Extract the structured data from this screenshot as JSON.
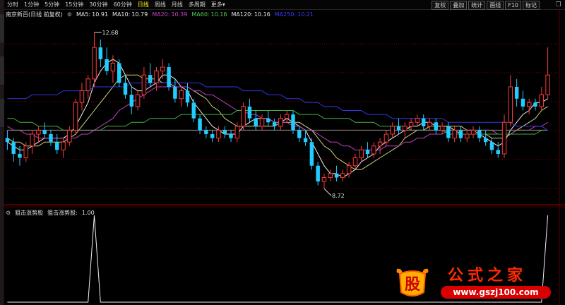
{
  "toolbar": {
    "periods": [
      "分时",
      "1分钟",
      "5分钟",
      "15分钟",
      "30分钟",
      "60分钟",
      "日线",
      "周线",
      "月线",
      "多周期",
      "更多"
    ],
    "active_period": "日线",
    "buttons": [
      "复权",
      "叠加",
      "统计",
      "画线",
      "F10",
      "标记"
    ]
  },
  "chart_title": "南京新百(日线 前复权)",
  "ma_legend": [
    {
      "label": "MA5:",
      "value": "10.91",
      "color": "#e8e8e8"
    },
    {
      "label": "MA10:",
      "value": "10.79",
      "color": "#e8e8e8"
    },
    {
      "label": "MA20:",
      "value": "10.39",
      "color": "#cc44cc"
    },
    {
      "label": "MA60:",
      "value": "10.16",
      "color": "#55cc55"
    },
    {
      "label": "MA120:",
      "value": "10.16",
      "color": "#e8e8e8"
    },
    {
      "label": "MA250:",
      "value": "10.21",
      "color": "#3a3aff"
    }
  ],
  "indicator": {
    "name": "狙击涨势股",
    "series_label": "狙击涨势股:",
    "value": "1.00"
  },
  "watermark": {
    "logo_char": "股",
    "title": "公式之家",
    "url": "www.gszj100.com"
  },
  "colors": {
    "up": "#ff3a3a",
    "down": "#22ccff",
    "grid": "#7a0000"
  },
  "chart_data": [
    {
      "type": "candlestick",
      "price_range": [
        8.4,
        13.0
      ],
      "annotations": [
        {
          "text": "12.68",
          "label": "max"
        },
        {
          "text": "8.72",
          "label": "min"
        }
      ],
      "candles": [
        [
          10.0,
          10.2,
          9.7,
          9.9
        ],
        [
          9.9,
          10.0,
          9.4,
          9.6
        ],
        [
          9.6,
          9.8,
          9.3,
          9.5
        ],
        [
          9.5,
          9.9,
          9.4,
          9.8
        ],
        [
          9.8,
          10.2,
          9.6,
          10.1
        ],
        [
          10.1,
          10.3,
          9.9,
          10.2
        ],
        [
          10.2,
          10.4,
          10.0,
          10.1
        ],
        [
          10.1,
          10.2,
          9.8,
          9.9
        ],
        [
          9.9,
          10.1,
          9.6,
          9.7
        ],
        [
          9.7,
          10.0,
          9.5,
          9.9
        ],
        [
          9.9,
          10.3,
          9.8,
          10.2
        ],
        [
          10.2,
          11.0,
          10.1,
          10.9
        ],
        [
          10.9,
          11.4,
          10.7,
          11.2
        ],
        [
          11.2,
          11.6,
          11.0,
          11.5
        ],
        [
          11.5,
          12.68,
          11.3,
          12.3
        ],
        [
          12.3,
          12.5,
          11.8,
          12.0
        ],
        [
          12.0,
          12.3,
          11.6,
          11.7
        ],
        [
          11.7,
          12.1,
          11.4,
          11.9
        ],
        [
          11.9,
          12.0,
          11.3,
          11.4
        ],
        [
          11.4,
          11.6,
          11.0,
          11.1
        ],
        [
          11.1,
          11.3,
          10.6,
          10.8
        ],
        [
          10.8,
          11.2,
          10.7,
          11.1
        ],
        [
          11.1,
          11.8,
          11.0,
          11.6
        ],
        [
          11.6,
          11.9,
          11.3,
          11.4
        ],
        [
          11.4,
          11.8,
          11.2,
          11.7
        ],
        [
          11.7,
          12.0,
          11.5,
          11.8
        ],
        [
          11.8,
          11.9,
          11.2,
          11.3
        ],
        [
          11.3,
          11.5,
          10.9,
          11.0
        ],
        [
          11.0,
          11.3,
          10.8,
          11.2
        ],
        [
          11.2,
          11.4,
          10.8,
          10.9
        ],
        [
          10.9,
          11.0,
          10.4,
          10.5
        ],
        [
          10.5,
          10.6,
          10.1,
          10.2
        ],
        [
          10.2,
          10.3,
          10.0,
          10.1
        ],
        [
          10.1,
          10.2,
          9.9,
          10.0
        ],
        [
          10.0,
          10.3,
          9.9,
          10.2
        ],
        [
          10.2,
          10.3,
          10.0,
          10.1
        ],
        [
          10.1,
          10.2,
          9.9,
          10.0
        ],
        [
          10.0,
          10.4,
          9.9,
          10.3
        ],
        [
          10.3,
          10.9,
          10.2,
          10.8
        ],
        [
          10.8,
          11.0,
          10.4,
          10.5
        ],
        [
          10.5,
          10.7,
          10.2,
          10.3
        ],
        [
          10.3,
          10.6,
          10.2,
          10.5
        ],
        [
          10.5,
          10.7,
          10.3,
          10.4
        ],
        [
          10.4,
          10.5,
          10.2,
          10.3
        ],
        [
          10.3,
          10.6,
          10.2,
          10.5
        ],
        [
          10.5,
          10.7,
          10.4,
          10.6
        ],
        [
          10.6,
          10.7,
          10.1,
          10.2
        ],
        [
          10.2,
          10.3,
          9.9,
          10.0
        ],
        [
          10.0,
          10.2,
          9.8,
          9.9
        ],
        [
          9.9,
          10.0,
          9.2,
          9.3
        ],
        [
          9.3,
          9.4,
          8.8,
          8.9
        ],
        [
          8.9,
          9.1,
          8.72,
          9.0
        ],
        [
          9.0,
          9.2,
          8.9,
          9.1
        ],
        [
          9.1,
          9.3,
          8.9,
          9.0
        ],
        [
          9.0,
          9.2,
          8.9,
          9.1
        ],
        [
          9.1,
          9.4,
          9.0,
          9.3
        ],
        [
          9.3,
          9.6,
          9.2,
          9.5
        ],
        [
          9.5,
          9.8,
          9.4,
          9.7
        ],
        [
          9.7,
          9.9,
          9.5,
          9.6
        ],
        [
          9.6,
          9.9,
          9.5,
          9.8
        ],
        [
          9.8,
          10.0,
          9.6,
          9.9
        ],
        [
          9.9,
          10.2,
          9.8,
          10.1
        ],
        [
          10.1,
          10.4,
          10.0,
          10.3
        ],
        [
          10.3,
          10.5,
          10.1,
          10.2
        ],
        [
          10.2,
          10.4,
          10.0,
          10.3
        ],
        [
          10.3,
          10.5,
          10.2,
          10.4
        ],
        [
          10.4,
          10.6,
          10.3,
          10.5
        ],
        [
          10.5,
          10.6,
          10.2,
          10.3
        ],
        [
          10.3,
          10.5,
          10.2,
          10.4
        ],
        [
          10.4,
          10.5,
          10.1,
          10.2
        ],
        [
          10.2,
          10.4,
          10.1,
          10.3
        ],
        [
          10.3,
          10.4,
          9.9,
          10.0
        ],
        [
          10.0,
          10.3,
          9.9,
          10.2
        ],
        [
          10.2,
          10.3,
          9.9,
          10.0
        ],
        [
          10.0,
          10.2,
          9.9,
          10.1
        ],
        [
          10.1,
          10.3,
          10.0,
          10.2
        ],
        [
          10.2,
          10.3,
          9.9,
          10.0
        ],
        [
          10.0,
          10.2,
          9.8,
          9.9
        ],
        [
          9.9,
          10.0,
          9.6,
          9.7
        ],
        [
          9.7,
          9.9,
          9.5,
          9.6
        ],
        [
          9.6,
          10.6,
          9.5,
          10.4
        ],
        [
          10.4,
          11.6,
          10.3,
          11.3
        ],
        [
          11.3,
          11.5,
          10.8,
          11.0
        ],
        [
          11.0,
          11.2,
          10.7,
          10.8
        ],
        [
          10.8,
          11.0,
          10.6,
          10.9
        ],
        [
          10.9,
          11.0,
          10.7,
          10.8
        ],
        [
          10.8,
          11.3,
          10.7,
          11.1
        ],
        [
          11.1,
          12.3,
          11.0,
          11.6
        ]
      ],
      "ma": {
        "MA5": [
          9.9,
          9.8,
          9.7,
          9.7,
          9.8,
          9.9,
          10.0,
          10.0,
          10.0,
          10.0,
          10.1,
          10.3,
          10.6,
          10.9,
          11.4,
          11.7,
          11.9,
          12.0,
          11.9,
          11.6,
          11.3,
          11.2,
          11.2,
          11.3,
          11.4,
          11.6,
          11.6,
          11.5,
          11.3,
          11.2,
          10.9,
          10.7,
          10.5,
          10.3,
          10.2,
          10.1,
          10.1,
          10.1,
          10.3,
          10.4,
          10.5,
          10.5,
          10.5,
          10.4,
          10.4,
          10.5,
          10.4,
          10.3,
          10.2,
          9.9,
          9.6,
          9.3,
          9.1,
          9.1,
          9.0,
          9.1,
          9.2,
          9.4,
          9.5,
          9.6,
          9.8,
          9.9,
          10.0,
          10.1,
          10.2,
          10.3,
          10.3,
          10.4,
          10.4,
          10.3,
          10.3,
          10.3,
          10.2,
          10.1,
          10.1,
          10.1,
          10.1,
          10.0,
          9.9,
          9.8,
          9.9,
          10.2,
          10.4,
          10.6,
          10.7,
          10.9,
          10.9,
          11.0
        ],
        "MA10": [
          10.0,
          9.9,
          9.9,
          9.8,
          9.8,
          9.8,
          9.9,
          9.9,
          9.9,
          9.9,
          10.0,
          10.1,
          10.3,
          10.5,
          10.7,
          10.9,
          11.1,
          11.3,
          11.5,
          11.6,
          11.6,
          11.6,
          11.5,
          11.5,
          11.5,
          11.4,
          11.4,
          11.3,
          11.3,
          11.3,
          11.2,
          11.1,
          11.0,
          10.8,
          10.7,
          10.5,
          10.4,
          10.3,
          10.3,
          10.3,
          10.3,
          10.3,
          10.3,
          10.3,
          10.4,
          10.4,
          10.4,
          10.4,
          10.3,
          10.2,
          10.0,
          9.8,
          9.7,
          9.5,
          9.4,
          9.3,
          9.2,
          9.2,
          9.3,
          9.4,
          9.5,
          9.6,
          9.7,
          9.8,
          10.0,
          10.1,
          10.2,
          10.2,
          10.3,
          10.3,
          10.3,
          10.3,
          10.3,
          10.3,
          10.2,
          10.2,
          10.1,
          10.1,
          10.0,
          10.0,
          10.0,
          10.1,
          10.2,
          10.3,
          10.4,
          10.5,
          10.7,
          10.8
        ],
        "MA20": [
          10.3,
          10.2,
          10.2,
          10.1,
          10.1,
          10.0,
          10.0,
          10.0,
          10.0,
          10.0,
          10.0,
          10.0,
          10.1,
          10.1,
          10.2,
          10.3,
          10.4,
          10.5,
          10.7,
          10.8,
          10.9,
          11.0,
          11.1,
          11.2,
          11.3,
          11.3,
          11.3,
          11.3,
          11.3,
          11.3,
          11.2,
          11.2,
          11.1,
          11.1,
          11.0,
          10.9,
          10.8,
          10.7,
          10.7,
          10.6,
          10.6,
          10.5,
          10.5,
          10.4,
          10.4,
          10.4,
          10.3,
          10.3,
          10.2,
          10.2,
          10.1,
          10.0,
          9.9,
          9.9,
          9.8,
          9.8,
          9.7,
          9.7,
          9.7,
          9.7,
          9.7,
          9.8,
          9.8,
          9.8,
          9.9,
          9.9,
          10.0,
          10.0,
          10.1,
          10.1,
          10.1,
          10.2,
          10.2,
          10.2,
          10.2,
          10.2,
          10.2,
          10.2,
          10.2,
          10.1,
          10.1,
          10.1,
          10.2,
          10.2,
          10.2,
          10.3,
          10.3,
          10.4
        ],
        "MA60": [
          10.5,
          10.5,
          10.4,
          10.4,
          10.4,
          10.3,
          10.3,
          10.3,
          10.3,
          10.2,
          10.2,
          10.2,
          10.2,
          10.2,
          10.2,
          10.2,
          10.3,
          10.3,
          10.3,
          10.3,
          10.4,
          10.4,
          10.4,
          10.5,
          10.5,
          10.5,
          10.5,
          10.5,
          10.6,
          10.6,
          10.6,
          10.6,
          10.6,
          10.6,
          10.6,
          10.6,
          10.6,
          10.7,
          10.7,
          10.7,
          10.7,
          10.7,
          10.7,
          10.7,
          10.7,
          10.7,
          10.7,
          10.6,
          10.6,
          10.6,
          10.6,
          10.5,
          10.5,
          10.5,
          10.5,
          10.5,
          10.4,
          10.4,
          10.4,
          10.4,
          10.3,
          10.3,
          10.3,
          10.3,
          10.3,
          10.2,
          10.2,
          10.2,
          10.2,
          10.2,
          10.2,
          10.1,
          10.1,
          10.1,
          10.1,
          10.1,
          10.1,
          10.1,
          10.1,
          10.1,
          10.1,
          10.1,
          10.1,
          10.1,
          10.1,
          10.1,
          10.2,
          10.2
        ],
        "MA120": [
          10.2,
          10.2,
          10.2,
          10.2,
          10.2,
          10.2,
          10.2,
          10.2,
          10.2,
          10.2,
          10.2,
          10.2,
          10.2,
          10.2,
          10.2,
          10.2,
          10.2,
          10.2,
          10.2,
          10.2,
          10.2,
          10.2,
          10.2,
          10.2,
          10.2,
          10.2,
          10.2,
          10.2,
          10.2,
          10.2,
          10.2,
          10.2,
          10.2,
          10.2,
          10.2,
          10.2,
          10.2,
          10.2,
          10.2,
          10.2,
          10.2,
          10.2,
          10.2,
          10.2,
          10.2,
          10.2,
          10.2,
          10.2,
          10.2,
          10.2,
          10.2,
          10.2,
          10.2,
          10.2,
          10.2,
          10.2,
          10.2,
          10.2,
          10.2,
          10.2,
          10.2,
          10.2,
          10.2,
          10.2,
          10.2,
          10.2,
          10.2,
          10.2,
          10.2,
          10.2,
          10.2,
          10.2,
          10.2,
          10.2,
          10.2,
          10.2,
          10.2,
          10.2,
          10.2,
          10.2,
          10.2,
          10.2,
          10.2,
          10.2,
          10.2,
          10.2,
          10.2,
          10.2
        ],
        "MA250": [
          11.0,
          11.0,
          11.0,
          11.0,
          11.1,
          11.1,
          11.1,
          11.1,
          11.1,
          11.2,
          11.2,
          11.2,
          11.2,
          11.2,
          11.3,
          11.3,
          11.3,
          11.3,
          11.3,
          11.3,
          11.4,
          11.4,
          11.4,
          11.4,
          11.4,
          11.4,
          11.4,
          11.4,
          11.4,
          11.4,
          11.4,
          11.4,
          11.3,
          11.3,
          11.3,
          11.3,
          11.3,
          11.3,
          11.2,
          11.2,
          11.2,
          11.2,
          11.1,
          11.1,
          11.1,
          11.0,
          11.0,
          11.0,
          10.9,
          10.9,
          10.9,
          10.8,
          10.8,
          10.8,
          10.7,
          10.7,
          10.7,
          10.7,
          10.6,
          10.6,
          10.6,
          10.6,
          10.5,
          10.5,
          10.5,
          10.5,
          10.5,
          10.5,
          10.5,
          10.5,
          10.5,
          10.4,
          10.4,
          10.4,
          10.4,
          10.4,
          10.4,
          10.4,
          10.4,
          10.4,
          10.4,
          10.4,
          10.3,
          10.3,
          10.3,
          10.3,
          10.3,
          10.2
        ]
      }
    },
    {
      "type": "line",
      "name": "狙击涨势股",
      "ylim": [
        0,
        1
      ],
      "values": [
        0,
        0,
        0,
        0,
        0,
        0,
        0,
        0,
        0,
        0,
        0,
        0,
        0,
        0,
        1,
        0,
        0,
        0,
        0,
        0,
        0,
        0,
        0,
        0,
        0,
        0,
        0,
        0,
        0,
        0,
        0,
        0,
        0,
        0,
        0,
        0,
        0,
        0,
        0,
        0,
        0,
        0,
        0,
        0,
        0,
        0,
        0,
        0,
        0,
        0,
        0,
        0,
        0,
        0,
        0,
        0,
        0,
        0,
        0,
        0,
        0,
        0,
        0,
        0,
        0,
        0,
        0,
        0,
        0,
        0,
        0,
        0,
        0,
        0,
        0,
        0,
        0,
        0,
        0,
        0,
        0,
        0,
        0,
        0,
        0,
        0,
        0,
        1
      ]
    }
  ]
}
